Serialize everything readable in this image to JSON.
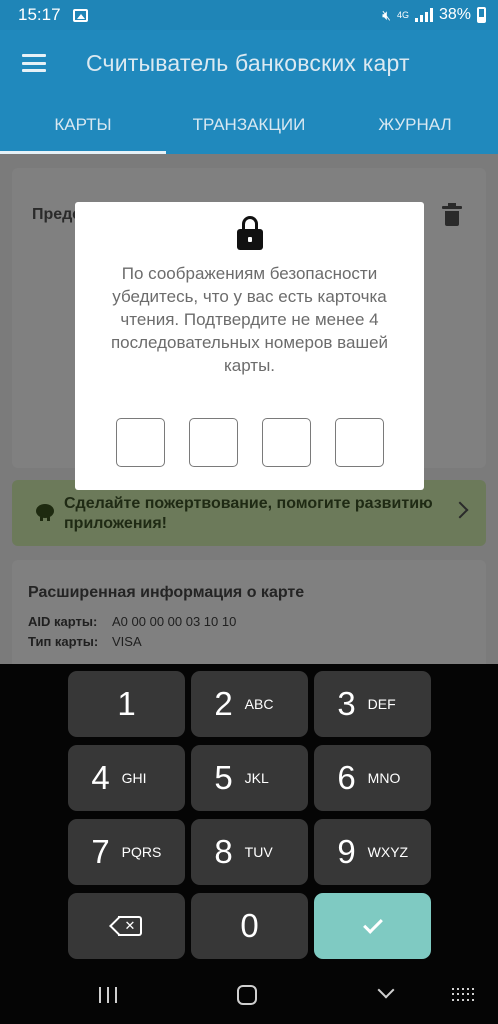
{
  "status_bar": {
    "time": "15:17",
    "network": "4G",
    "battery": "38%"
  },
  "app_bar": {
    "title": "Считыватель банковских карт"
  },
  "tabs": [
    {
      "label": "КАРТЫ",
      "active": true
    },
    {
      "label": "ТРАНЗАКЦИИ",
      "active": false
    },
    {
      "label": "ЖУРНАЛ",
      "active": false
    }
  ],
  "card_view": {
    "title": "Представление карты"
  },
  "donate": {
    "text": "Сделайте пожертвование, помогите развитию приложения!"
  },
  "extended": {
    "title": "Расширенная информация о карте",
    "aid_label": "AID карты:",
    "aid_value": "A0 00 00 00 03 10 10",
    "type_label": "Тип карты:",
    "type_value": "VISA"
  },
  "dialog": {
    "message": "По соображениям безопасности убедитесь, что у вас есть карточка чтения. Подтвердите не менее 4 последовательных номеров вашей карты.",
    "pin_values": [
      "",
      "",
      "",
      ""
    ]
  },
  "keyboard": {
    "keys": [
      {
        "num": "1",
        "letters": ""
      },
      {
        "num": "2",
        "letters": "ABC"
      },
      {
        "num": "3",
        "letters": "DEF"
      },
      {
        "num": "4",
        "letters": "GHI"
      },
      {
        "num": "5",
        "letters": "JKL"
      },
      {
        "num": "6",
        "letters": "MNO"
      },
      {
        "num": "7",
        "letters": "PQRS"
      },
      {
        "num": "8",
        "letters": "TUV"
      },
      {
        "num": "9",
        "letters": "WXYZ"
      },
      {
        "num": "0",
        "letters": ""
      }
    ],
    "ok_color": "#7fcac2"
  },
  "colors": {
    "primary": "#2089bd",
    "status_bar": "#1f85b7"
  }
}
